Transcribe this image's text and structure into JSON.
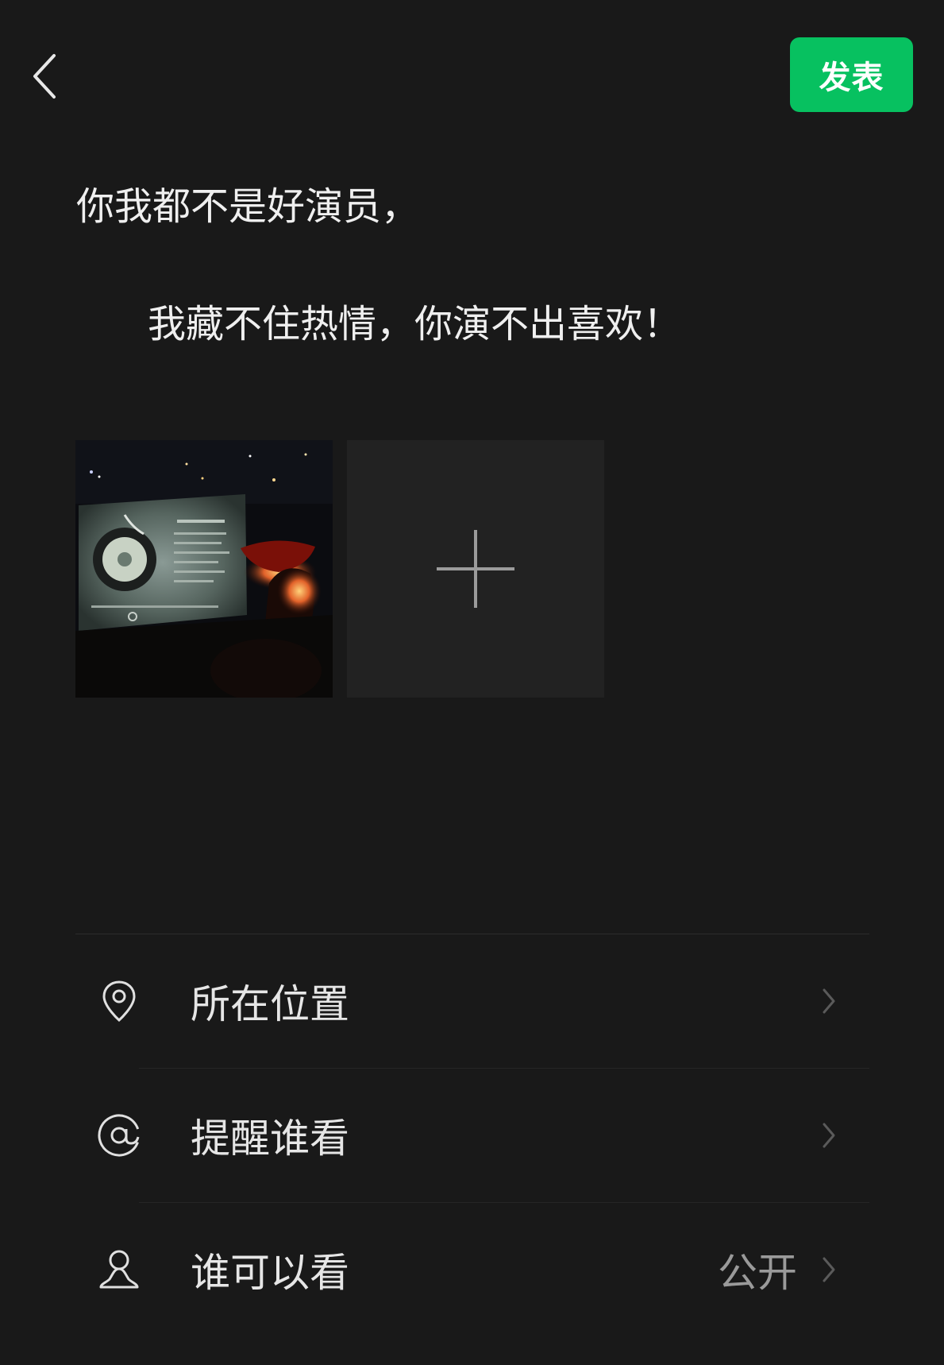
{
  "header": {
    "publish_label": "发表"
  },
  "post": {
    "line1": "你我都不是好演员，",
    "line2": "我藏不住热情，你演不出喜欢！"
  },
  "options": {
    "location_label": "所在位置",
    "remind_label": "提醒谁看",
    "visibility_label": "谁可以看",
    "visibility_value": "公开"
  },
  "colors": {
    "publish_bg": "#07c160",
    "background": "#191919"
  },
  "icons": {
    "back": "chevron-left-icon",
    "add": "plus-icon",
    "location": "location-pin-icon",
    "remind": "at-icon",
    "visibility": "person-icon",
    "chevron": "chevron-right-icon"
  }
}
